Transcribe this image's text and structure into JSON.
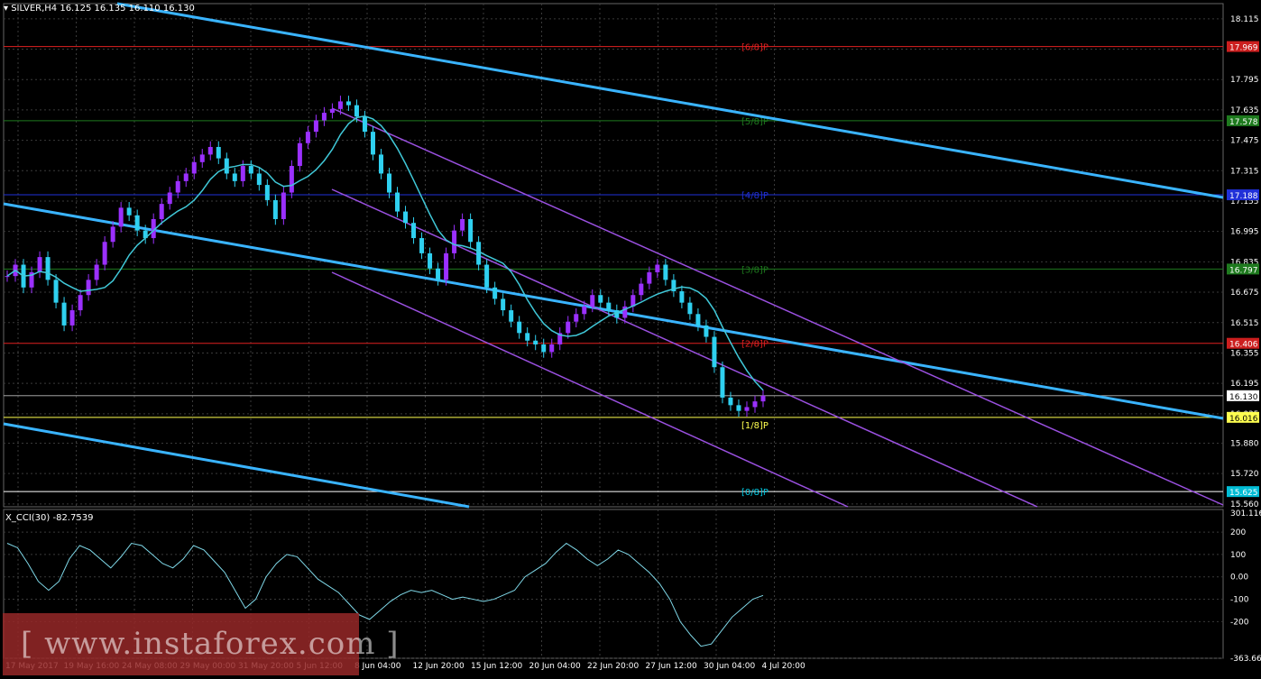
{
  "window": {
    "symbol_title": "SILVER,H4",
    "ohlc_text": "16.125 16.135 16.110 16.130",
    "indicator_title": "X_CCI(30) -82.7539",
    "watermark": "[ www.instaforex.com ]"
  },
  "colors": {
    "background": "#000000",
    "grid": "#3a3a3a",
    "bull_candle": "#9b30ff",
    "bear_candle": "#2fd0f0",
    "moving_average": "#40c8d8",
    "regression_channel": "#9a50e0",
    "trend_lines": "#3ab4ff",
    "cci_line": "#7fd8e8",
    "murrey_red": "#e02020",
    "murrey_green": "#1e7a1e",
    "murrey_blue": "#2030d8",
    "murrey_yellow": "#ffff50",
    "watermark_bg": "#962828"
  },
  "chart_data": {
    "type": "candlestick",
    "price_axis_ticks": [
      "18.115",
      "17.955",
      "17.795",
      "17.635",
      "17.475",
      "17.315",
      "17.155",
      "16.995",
      "16.835",
      "16.675",
      "16.515",
      "16.355",
      "16.195",
      "16.035",
      "15.880",
      "15.720",
      "15.560"
    ],
    "price_range": [
      15.545,
      18.195
    ],
    "time_axis_labels": [
      "17 May 2017",
      "19 May 16:00",
      "24 May 08:00",
      "29 May 00:00",
      "31 May 20:00",
      "5 Jun 12:00",
      "8 Jun 04:00",
      "12 Jun 20:00",
      "15 Jun 12:00",
      "20 Jun 04:00",
      "22 Jun 20:00",
      "27 Jun 12:00",
      "30 Jun 04:00",
      "4 Jul 20:00"
    ],
    "murrey_levels": [
      {
        "label": "[6/8]P",
        "value": "17.969",
        "price": 17.969,
        "color": "red",
        "tag_color": "#cc1e1e"
      },
      {
        "label": "[5/8]P",
        "value": "17.578",
        "price": 17.578,
        "color": "green",
        "tag_color": "#1e7a1e"
      },
      {
        "label": "[4/8]P",
        "value": "17.188",
        "price": 17.188,
        "color": "blue",
        "tag_color": "#2030d8"
      },
      {
        "label": "[3/8]P",
        "value": "16.797",
        "price": 16.797,
        "color": "green",
        "tag_color": "#1e7a1e"
      },
      {
        "label": "[2/8]P",
        "value": "16.406",
        "price": 16.406,
        "color": "red",
        "tag_color": "#cc1e1e"
      },
      {
        "label": "[1/8]P",
        "value": "16.016",
        "price": 16.016,
        "color": "yellow",
        "tag_color": "#ffff50"
      },
      {
        "label": "[0/8]P",
        "value": "15.625",
        "price": 15.625,
        "color": "white",
        "tag_color": "#00bcd4"
      }
    ],
    "current_price": {
      "value": "16.130",
      "price": 16.13
    },
    "cci": {
      "period": 30,
      "current": -82.7539,
      "axis_ticks": [
        "200",
        "100",
        "0.00",
        "-100",
        "-200",
        "-363.663"
      ],
      "top_label": "301.1164",
      "range": [
        -363.663,
        301.1164
      ]
    },
    "series_closes": [
      16.76,
      16.82,
      16.7,
      16.78,
      16.86,
      16.74,
      16.62,
      16.5,
      16.58,
      16.66,
      16.74,
      16.82,
      16.94,
      17.02,
      17.12,
      17.08,
      17.0,
      16.96,
      17.06,
      17.14,
      17.2,
      17.26,
      17.3,
      17.36,
      17.4,
      17.44,
      17.38,
      17.3,
      17.26,
      17.34,
      17.3,
      17.24,
      17.16,
      17.06,
      17.2,
      17.34,
      17.46,
      17.52,
      17.58,
      17.62,
      17.64,
      17.68,
      17.66,
      17.6,
      17.52,
      17.4,
      17.3,
      17.2,
      17.1,
      17.04,
      16.96,
      16.88,
      16.8,
      16.74,
      16.88,
      17.0,
      17.06,
      16.94,
      16.82,
      16.7,
      16.64,
      16.58,
      16.52,
      16.46,
      16.42,
      16.4,
      16.36,
      16.4,
      16.46,
      16.52,
      16.56,
      16.6,
      16.66,
      16.62,
      16.58,
      16.54,
      16.6,
      16.66,
      16.72,
      16.78,
      16.82,
      16.74,
      16.68,
      16.62,
      16.56,
      16.5,
      16.44,
      16.28,
      16.12,
      16.08,
      16.05,
      16.07,
      16.1,
      16.13
    ],
    "cci_values": [
      150,
      130,
      60,
      -20,
      -60,
      -20,
      80,
      140,
      120,
      80,
      40,
      90,
      150,
      140,
      100,
      60,
      40,
      80,
      140,
      120,
      70,
      20,
      -60,
      -140,
      -100,
      0,
      60,
      100,
      90,
      40,
      -10,
      -40,
      -70,
      -120,
      -170,
      -190,
      -150,
      -110,
      -80,
      -60,
      -70,
      -60,
      -80,
      -100,
      -90,
      -100,
      -110,
      -100,
      -80,
      -60,
      0,
      30,
      60,
      110,
      150,
      120,
      80,
      50,
      80,
      120,
      100,
      60,
      20,
      -30,
      -100,
      -200,
      -260,
      -310,
      -300,
      -240,
      -180,
      -140,
      -100,
      -83
    ],
    "grid": true
  }
}
